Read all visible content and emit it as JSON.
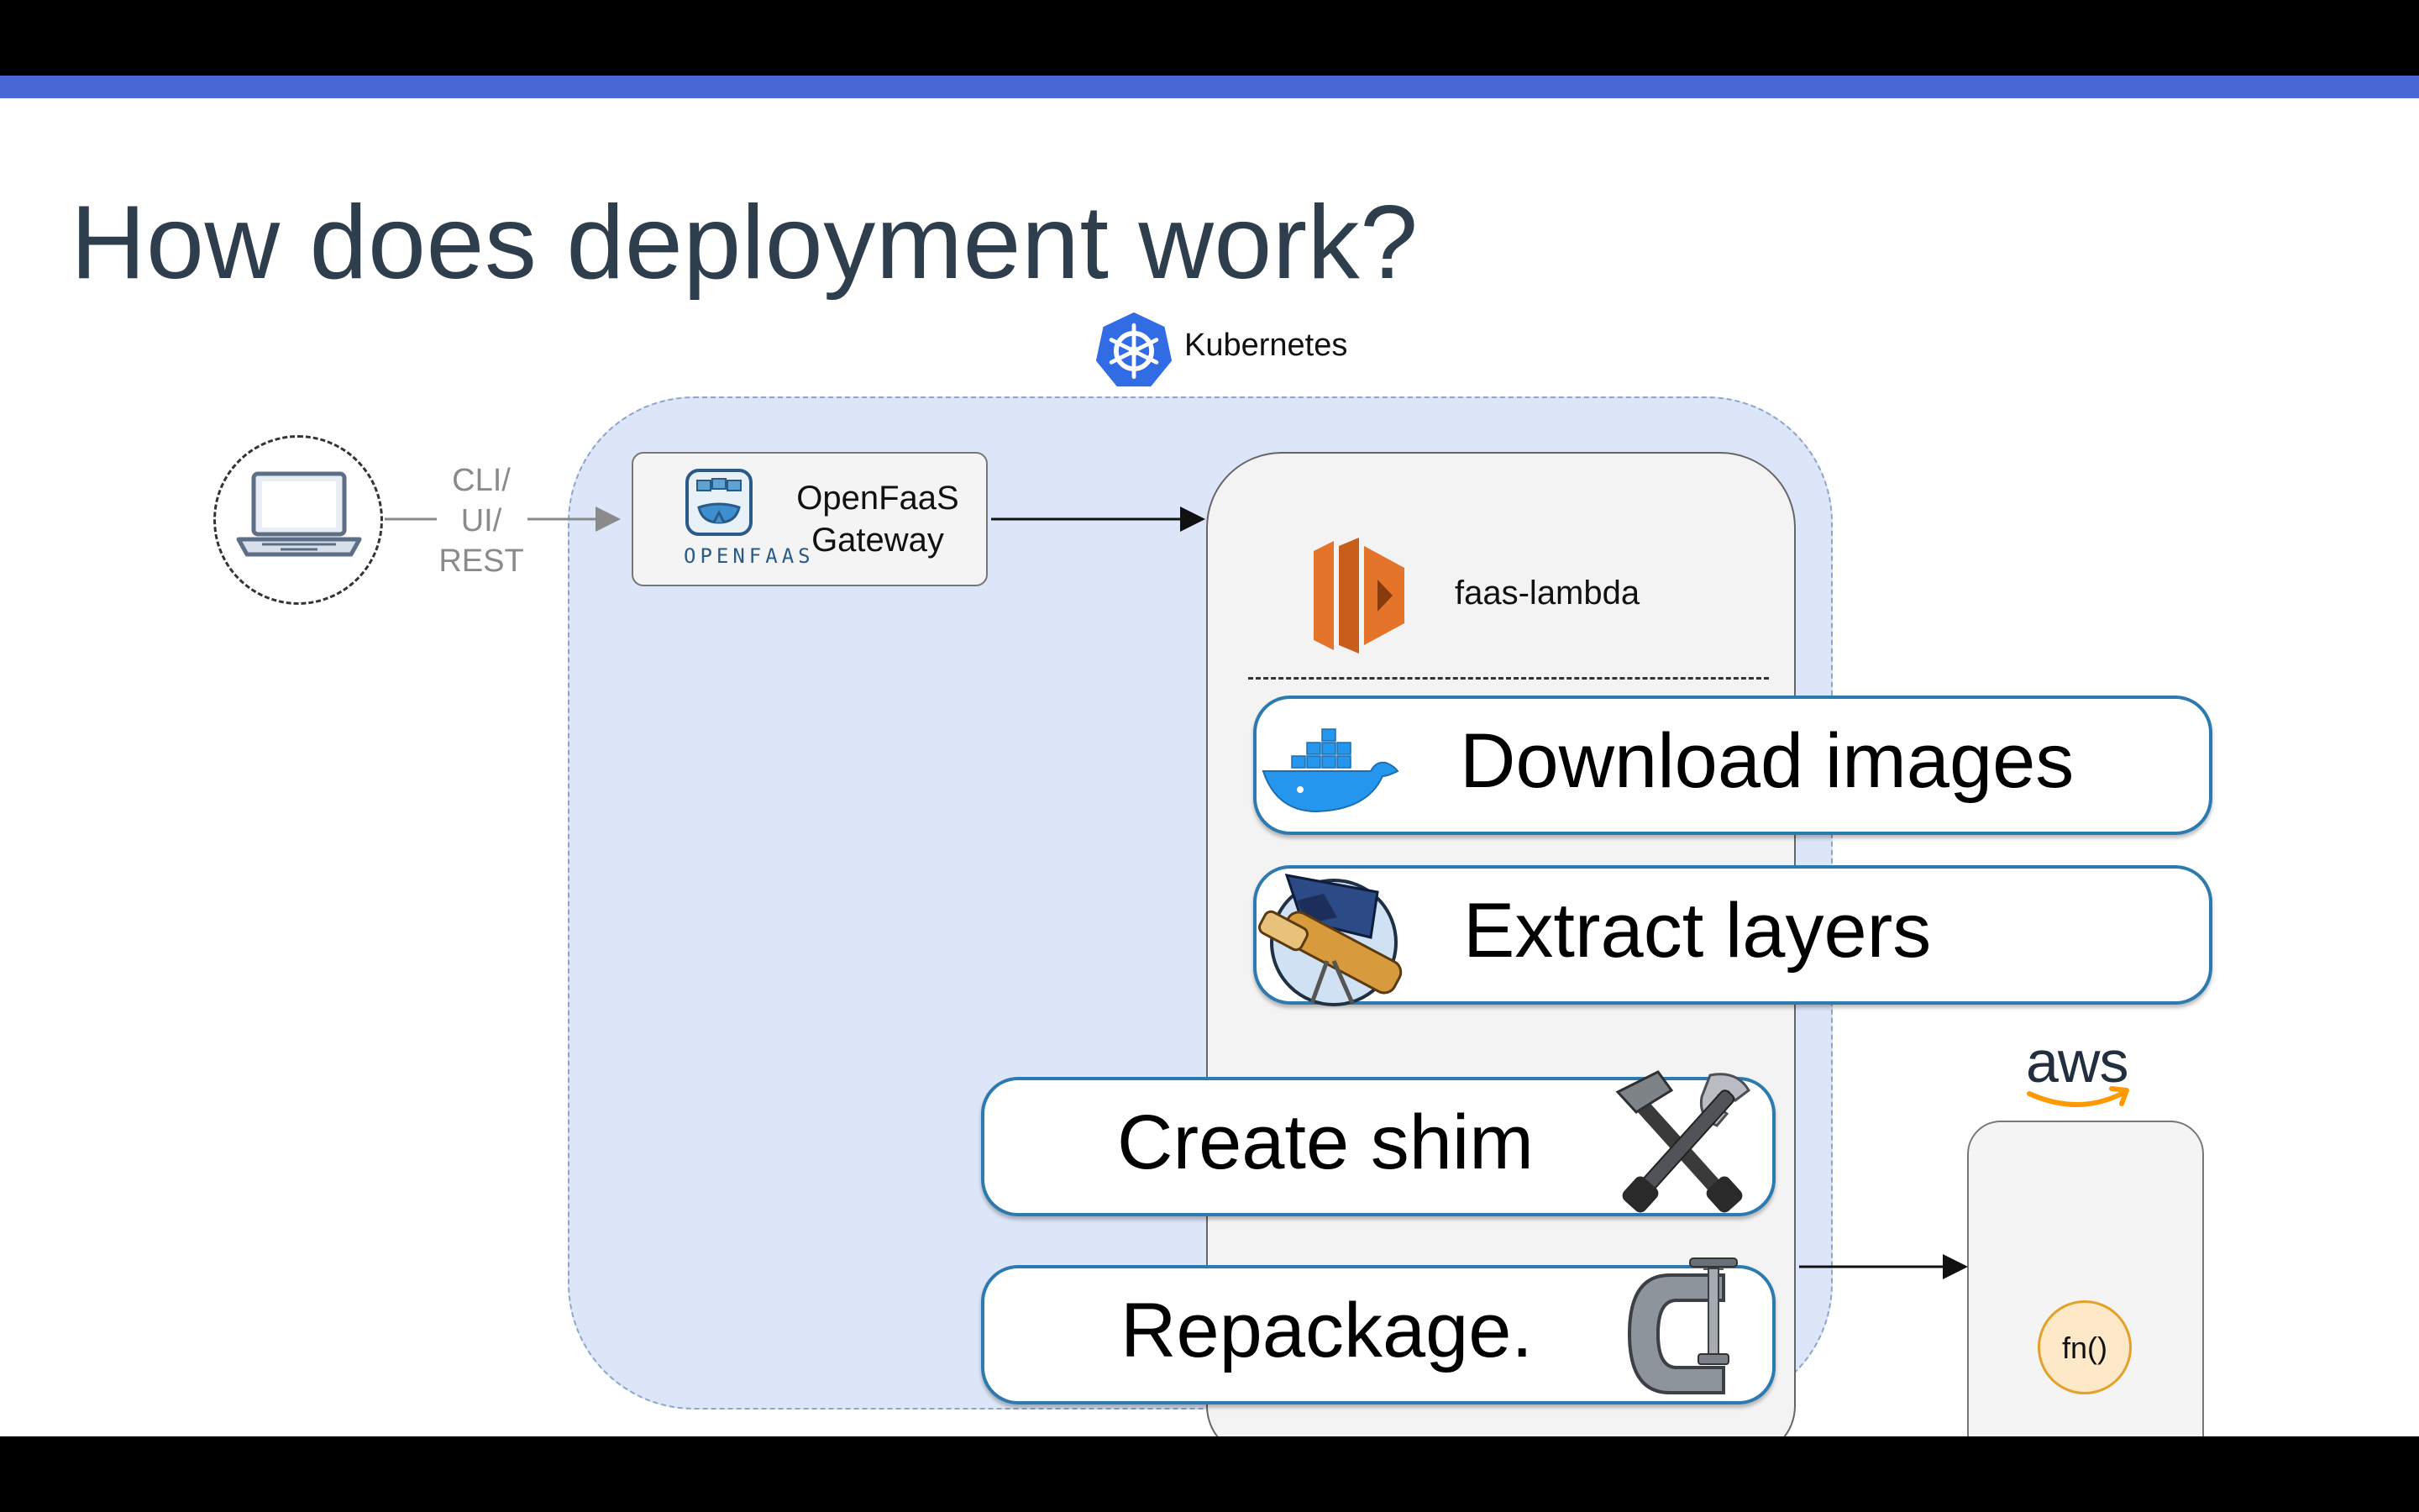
{
  "slide": {
    "title": "How does deployment work?",
    "accent_color": "#4a67d6"
  },
  "kubernetes": {
    "label": "Kubernetes",
    "logo_icon": "kubernetes-helm-icon"
  },
  "client": {
    "icon": "laptop-icon",
    "transport_label": "CLI/\nUI/\nREST"
  },
  "gateway": {
    "label": "OpenFaaS\nGateway",
    "logo_text": "OPENFAAS",
    "icon": "openfaas-whale-icon"
  },
  "lambda": {
    "label": "faas-lambda",
    "icon": "aws-lambda-icon"
  },
  "steps": [
    {
      "label": "Download images",
      "icon": "docker-whale-icon"
    },
    {
      "label": "Extract layers",
      "icon": "telescope-icon"
    },
    {
      "label": "Create shim",
      "icon": "hammer-wrench-icon"
    },
    {
      "label": "Repackage.",
      "icon": "c-clamp-icon"
    }
  ],
  "aws": {
    "logo_text": "aws",
    "function_label": "fn()"
  }
}
